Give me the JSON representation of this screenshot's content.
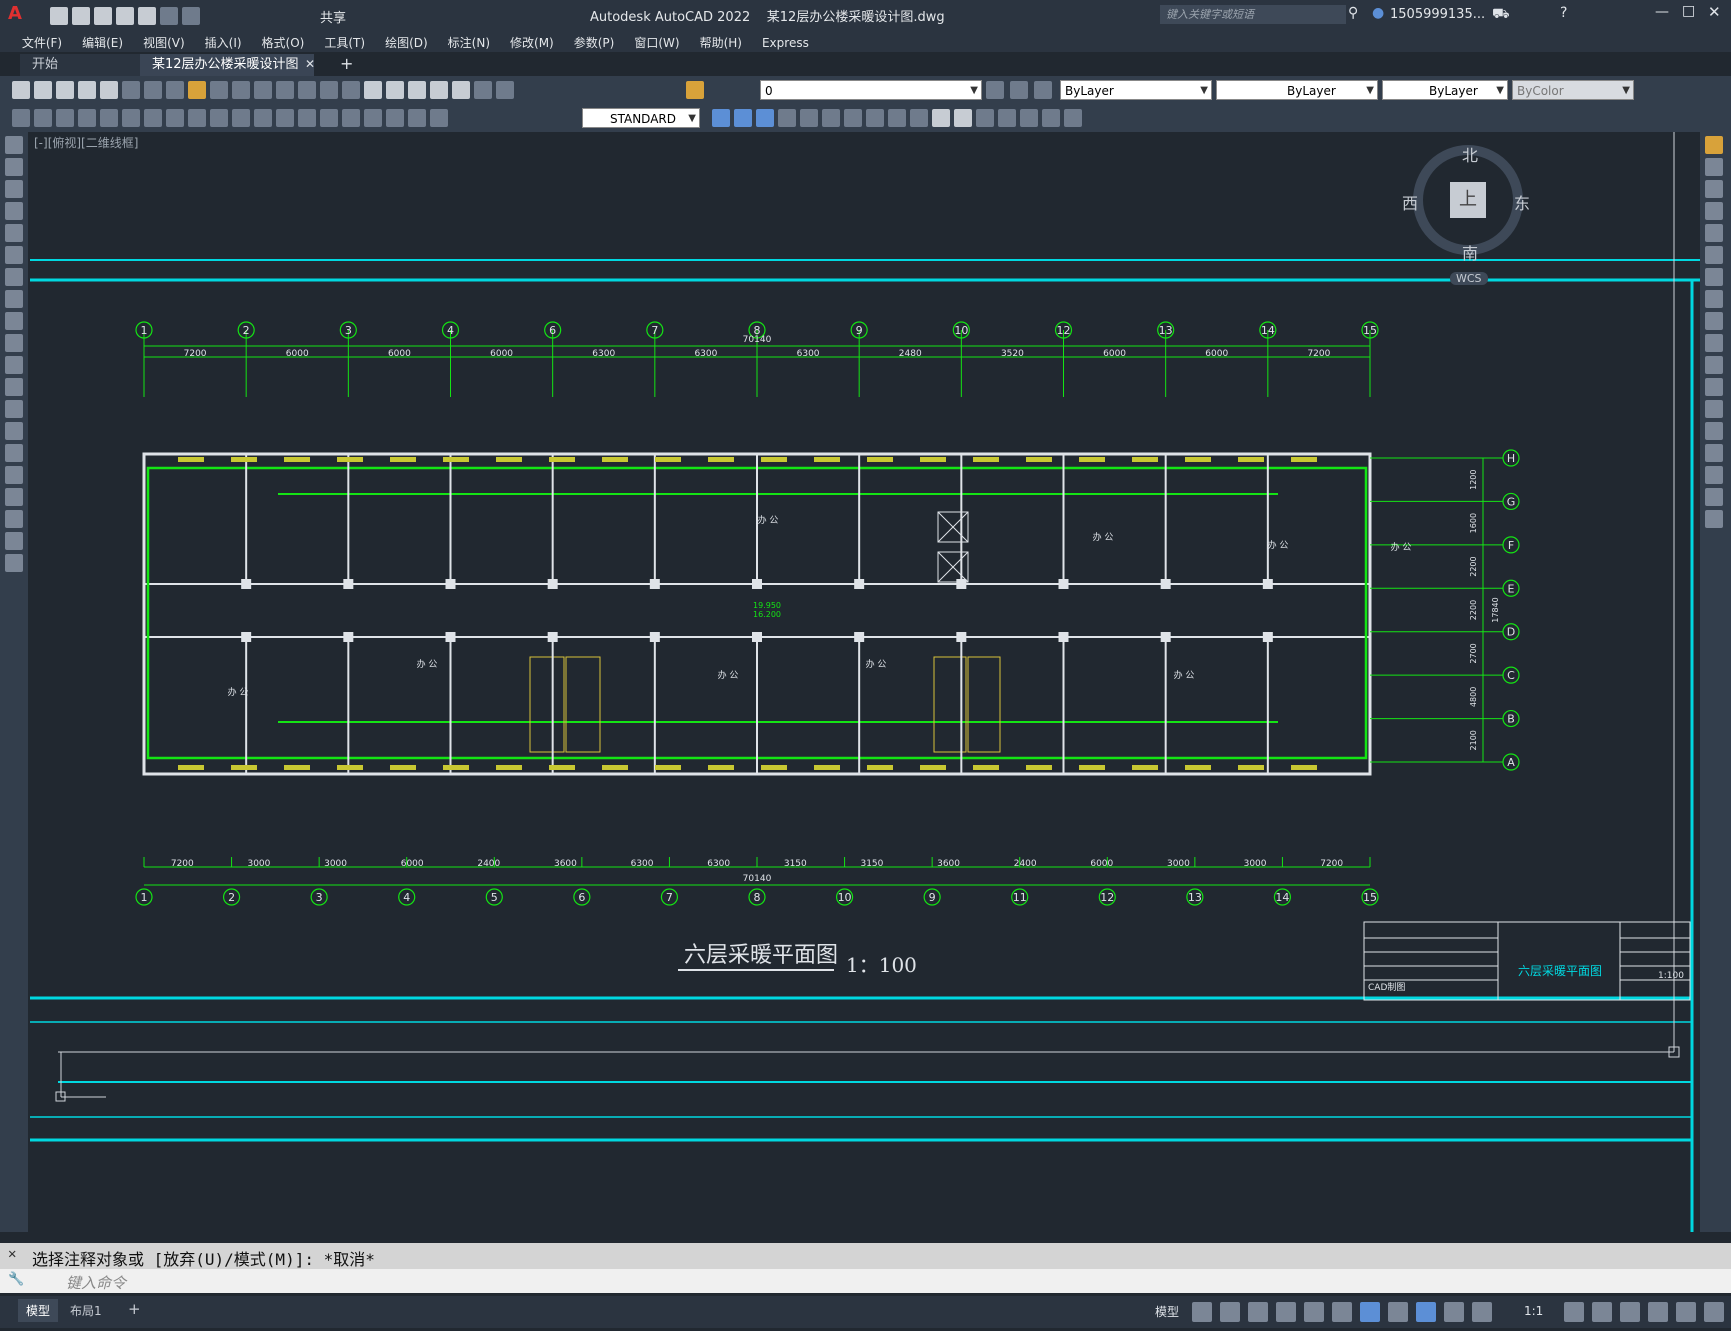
{
  "app": {
    "title": "Autodesk AutoCAD 2022    某12层办公楼采暖设计图.dwg",
    "share": "共享",
    "search_placeholder": "键入关键字或短语",
    "user": "1505999135...",
    "logo": "A"
  },
  "menus": [
    "文件(F)",
    "编辑(E)",
    "视图(V)",
    "插入(I)",
    "格式(O)",
    "工具(T)",
    "绘图(D)",
    "标注(N)",
    "修改(M)",
    "参数(P)",
    "窗口(W)",
    "帮助(H)",
    "Express"
  ],
  "tabs": {
    "start": "开始",
    "doc": "某12层办公楼采暖设计图*",
    "close": "✕",
    "add": "+"
  },
  "layer": {
    "name": "0"
  },
  "props": {
    "color": "ByLayer",
    "linetype": "ByLayer",
    "lineweight": "ByLayer",
    "plotstyle": "ByColor"
  },
  "textstyle": "STANDARD",
  "viewport_label": "[-][俯视][二维线框]",
  "viewcube": {
    "north": "北",
    "south": "南",
    "east": "东",
    "west": "西",
    "face": "上",
    "wcs": "WCS"
  },
  "drawing": {
    "title": "六层采暖平面图",
    "scale": "1：100",
    "titleblock_name": "六层采暖平面图",
    "grid_top": [
      "1",
      "2",
      "3",
      "4",
      "6",
      "7",
      "8",
      "9",
      "10",
      "12",
      "13",
      "14",
      "15"
    ],
    "grid_bottom": [
      "1",
      "2",
      "3",
      "4",
      "5",
      "6",
      "7",
      "8",
      "10",
      "9",
      "11",
      "12",
      "13",
      "14",
      "15"
    ],
    "grid_right": [
      "H",
      "G",
      "F",
      "E",
      "D",
      "C",
      "B",
      "A"
    ],
    "dims_top": [
      "7200",
      "6000",
      "6000",
      "6000",
      "6300",
      "6300",
      "6300",
      "2480",
      "3520",
      "6000",
      "6000",
      "7200"
    ],
    "dims_bottom": [
      "7200",
      "3000",
      "3000",
      "6000",
      "2400",
      "3600",
      "6300",
      "6300",
      "3150",
      "3150",
      "3600",
      "2400",
      "6000",
      "3000",
      "3000",
      "7200"
    ],
    "total_top": "70140",
    "total_bottom": "70140",
    "dims_right": [
      "1200",
      "1600",
      "2200",
      "2200",
      "2700",
      "4800",
      "2100"
    ],
    "total_right": "17840",
    "room_office": "办 公",
    "level_a": "19.950",
    "level_b": "16.200",
    "tb_scale": "1:100",
    "tb_cad": "CAD制图"
  },
  "command": {
    "history": "选择注释对象或 [放弃(U)/模式(M)]: *取消*",
    "prompt": "键入命令"
  },
  "status": {
    "model": "模型",
    "layout1": "布局1",
    "add": "+",
    "space": "模型",
    "scale": "1:1"
  }
}
